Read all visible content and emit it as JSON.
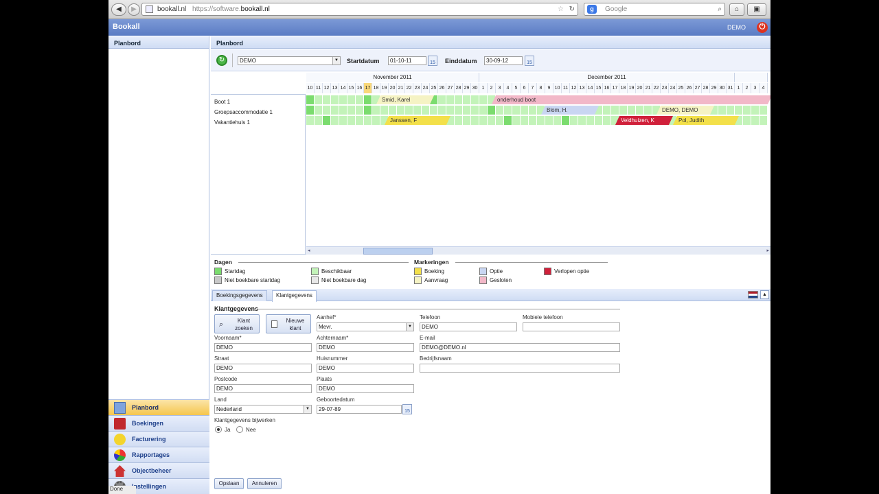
{
  "browser": {
    "url_host_label": "bookall.nl",
    "url_scheme": "https://software.",
    "url_domain": "bookall.nl",
    "search_placeholder": "Google",
    "status": "Done"
  },
  "app": {
    "title": "Bookall",
    "user": "DEMO"
  },
  "sidebar": {
    "header": "Planbord",
    "modules": [
      {
        "label": "Planbord",
        "icon": "calendar-icon",
        "active": true
      },
      {
        "label": "Boekingen",
        "icon": "book-icon"
      },
      {
        "label": "Facturering",
        "icon": "coin-icon"
      },
      {
        "label": "Rapportages",
        "icon": "pie-chart-icon"
      },
      {
        "label": "Objectbeheer",
        "icon": "house-icon"
      },
      {
        "label": "Instellingen",
        "icon": "gears-icon"
      }
    ]
  },
  "main": {
    "header": "Planbord",
    "toolbar": {
      "object_select": "DEMO",
      "start_label": "Startdatum",
      "start_value": "01-10-11",
      "end_label": "Einddatum",
      "end_value": "30-09-12",
      "cal_label": "15"
    },
    "planbord": {
      "months": [
        "November 2011",
        "December 2011"
      ],
      "days": [
        "10",
        "11",
        "12",
        "13",
        "14",
        "15",
        "16",
        "17",
        "18",
        "19",
        "20",
        "21",
        "22",
        "23",
        "24",
        "25",
        "26",
        "27",
        "28",
        "29",
        "30",
        "1",
        "2",
        "3",
        "4",
        "5",
        "6",
        "7",
        "8",
        "9",
        "10",
        "11",
        "12",
        "13",
        "14",
        "15",
        "16",
        "17",
        "18",
        "19",
        "20",
        "21",
        "22",
        "23",
        "24",
        "25",
        "26",
        "27",
        "28",
        "29",
        "30",
        "31",
        "1",
        "2",
        "3",
        "4"
      ],
      "today_index": 7,
      "objects": [
        "Boot 1",
        "Groepsaccommodatie 1",
        "Vakantiehuis 1"
      ],
      "bookings": [
        {
          "label": "Smid, Karel",
          "row": 0,
          "start": 8,
          "end": 15,
          "type": "aanvraag"
        },
        {
          "label": "onderhoud boot",
          "row": 0,
          "start": 22,
          "end": 56,
          "type": "gesloten"
        },
        {
          "label": "Blom, H.",
          "row": 1,
          "start": 28,
          "end": 35,
          "type": "optie"
        },
        {
          "label": "DEMO, DEMO",
          "row": 1,
          "start": 42,
          "end": 49,
          "type": "aanvraag"
        },
        {
          "label": "Janssen, F",
          "row": 2,
          "start": 9,
          "end": 17,
          "type": "boeking"
        },
        {
          "label": "Veldhuizen, K",
          "row": 2,
          "start": 37,
          "end": 44,
          "type": "verlopen"
        },
        {
          "label": "Pol, Judith",
          "row": 2,
          "start": 44,
          "end": 52,
          "type": "boeking"
        }
      ]
    },
    "legend": {
      "days_title": "Dagen",
      "markings_title": "Markeringen",
      "items": [
        {
          "label": "Startdag",
          "color": "#7bdc6e"
        },
        {
          "label": "Niet boekbare startdag",
          "color": "#c8c8c8"
        },
        {
          "label": "Beschikbaar",
          "color": "#c3f3b9"
        },
        {
          "label": "Niet boekbare dag",
          "color": "#e8e8e8"
        },
        {
          "label": "Boeking",
          "color": "#f3e04a"
        },
        {
          "label": "Aanvraag",
          "color": "#f5f3c4"
        },
        {
          "label": "Optie",
          "color": "#c9d6f2"
        },
        {
          "label": "Gesloten",
          "color": "#f2b8c8"
        },
        {
          "label": "Verlopen optie",
          "color": "#d0203a"
        }
      ]
    },
    "tabs": [
      "Boekingsgegevens",
      "Klantgegevens"
    ],
    "form": {
      "section_title": "Klantgegevens",
      "search_customer": "Klant zoeken",
      "new_customer": "Nieuwe klant",
      "aanhef_label": "Aanhef*",
      "aanhef_value": "Mevr.",
      "telefoon_label": "Telefoon",
      "telefoon_value": "DEMO",
      "mobiel_label": "Mobiele telefoon",
      "mobiel_value": "",
      "voornaam_label": "Voornaam*",
      "voornaam_value": "DEMO",
      "achternaam_label": "Achternaam*",
      "achternaam_value": "DEMO",
      "email_label": "E-mail",
      "email_value": "DEMO@DEMO.nl",
      "straat_label": "Straat",
      "straat_value": "DEMO",
      "huisnummer_label": "Huisnummer",
      "huisnummer_value": "DEMO",
      "bedrijf_label": "Bedrijfsnaam",
      "bedrijf_value": "",
      "postcode_label": "Postcode",
      "postcode_value": "DEMO",
      "plaats_label": "Plaats",
      "plaats_value": "DEMO",
      "land_label": "Land",
      "land_value": "Nederland",
      "geboorte_label": "Geboortedatum",
      "geboorte_value": "29-07-89",
      "update_label": "Klantgegevens bijwerken",
      "ja": "Ja",
      "nee": "Nee",
      "save": "Opslaan",
      "cancel": "Annuleren"
    }
  }
}
